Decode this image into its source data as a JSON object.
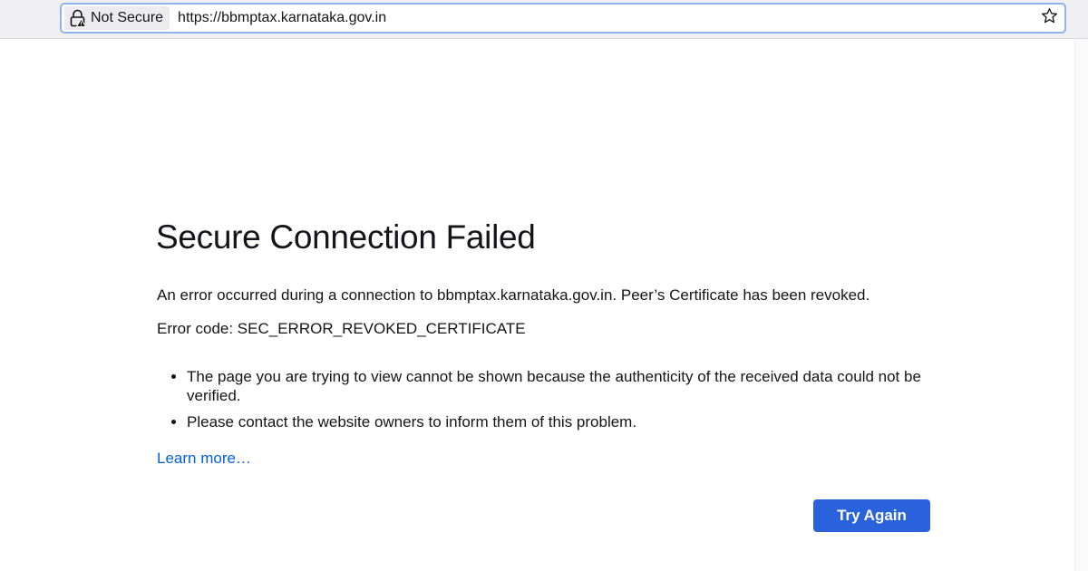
{
  "browser": {
    "identity_label": "Not Secure",
    "url": "https://bbmptax.karnataka.gov.in",
    "icons": {
      "identity": "insecure-lock-icon",
      "bookmark": "star-icon"
    }
  },
  "error_page": {
    "title": "Secure Connection Failed",
    "description": "An error occurred during a connection to bbmptax.karnataka.gov.in. Peer’s Certificate has been revoked.",
    "error_code": "Error code: SEC_ERROR_REVOKED_CERTIFICATE",
    "bullets": [
      "The page you are trying to view cannot be shown because the authenticity of the received data could not be verified.",
      "Please contact the website owners to inform them of this problem."
    ],
    "learn_more": "Learn more…",
    "try_again": "Try Again"
  },
  "colors": {
    "link": "#0060df",
    "primary_button": "#2a62de",
    "urlbar_focus": "#8fb4e8"
  }
}
